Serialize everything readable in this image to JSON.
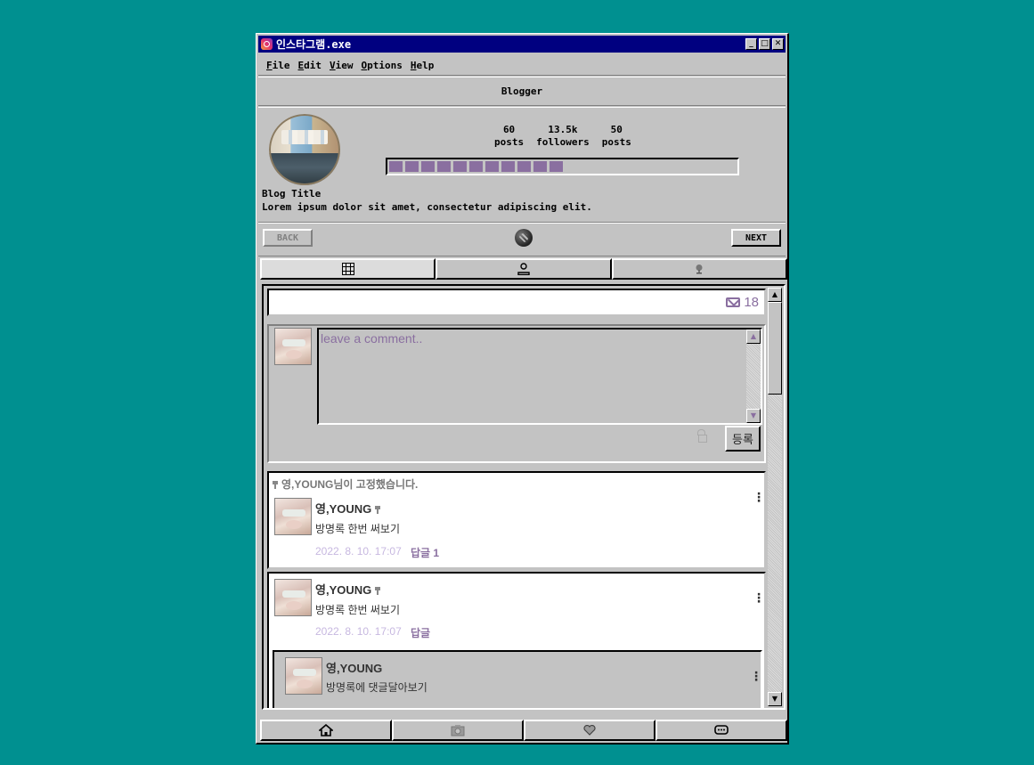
{
  "window": {
    "title": "인스타그램.exe"
  },
  "menu": [
    {
      "key": "F",
      "rest": "ile"
    },
    {
      "key": "E",
      "rest": "dit"
    },
    {
      "key": "V",
      "rest": "iew"
    },
    {
      "key": "O",
      "rest": "ptions"
    },
    {
      "key": "H",
      "rest": "elp"
    }
  ],
  "header": {
    "title": "Blogger"
  },
  "profile": {
    "stats": [
      {
        "num": "60",
        "label": "posts"
      },
      {
        "num": "13.5k",
        "label": "followers"
      },
      {
        "num": "50",
        "label": "posts"
      }
    ],
    "progress_fraction": 0.5,
    "progress_blocks": 11,
    "blog_title": "Blog Title",
    "blog_desc": "Lorem ipsum dolor sit amet, consectetur adipiscing elit."
  },
  "nav": {
    "back": "BACK",
    "next": "NEXT"
  },
  "guestbook": {
    "count": "18",
    "placeholder": "leave a comment..",
    "submit": "등록",
    "pinned_note": "영,YOUNG님이 고정했습니다.",
    "comments": [
      {
        "name": "영,YOUNG",
        "text": "방명록 한번 써보기",
        "date": "2022. 8. 10. 17:07",
        "reply": "답글 1"
      },
      {
        "name": "영,YOUNG",
        "text": "방명록 한번 써보기",
        "date": "2022. 8. 10. 17:07",
        "reply": "답글"
      }
    ],
    "reply": {
      "name": "영,YOUNG",
      "text": "방명록에 댓글달아보기"
    }
  },
  "colors": {
    "desktop": "#009090",
    "titlebar": "#000080",
    "accent": "#8a6fa0",
    "date": "#c7b8e0"
  }
}
